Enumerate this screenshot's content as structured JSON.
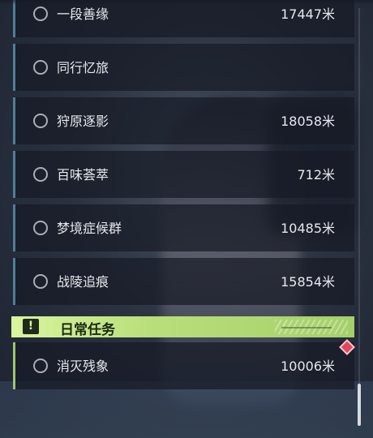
{
  "quests": [
    {
      "name": "一段善缘",
      "distance": "17447米"
    },
    {
      "name": "同行忆旅",
      "distance": ""
    },
    {
      "name": "狩原逐影",
      "distance": "18058米"
    },
    {
      "name": "百味荟萃",
      "distance": "712米"
    },
    {
      "name": "梦境症候群",
      "distance": "10485米"
    },
    {
      "name": "战陵追痕",
      "distance": "15854米"
    }
  ],
  "daily_section": {
    "title": "日常任务",
    "icon": "exclamation-icon",
    "items": [
      {
        "name": "消灭残象",
        "distance": "10006米"
      }
    ]
  },
  "colors": {
    "accent_bar": "#4f7f95",
    "daily_accent": "#a5cf6a",
    "marker": "#e0475c"
  }
}
